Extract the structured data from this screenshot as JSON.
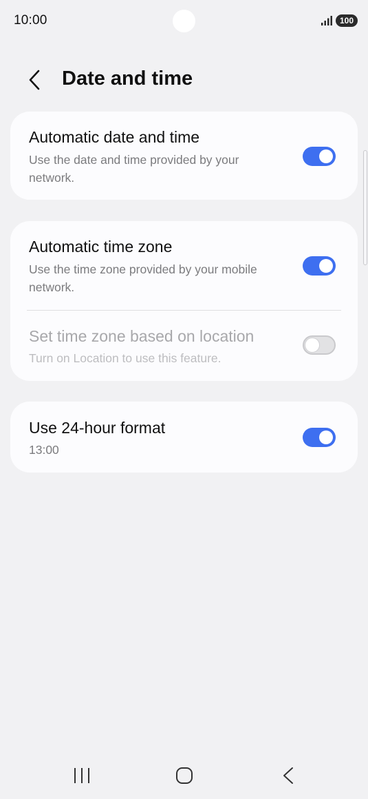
{
  "status_bar": {
    "time": "10:00",
    "battery": "100",
    "signal_icon": "signal-icon"
  },
  "header": {
    "title": "Date and time",
    "back_icon": "back-chevron-icon"
  },
  "settings": {
    "automatic_date_time": {
      "title": "Automatic date and time",
      "subtitle": "Use the date and time provided by your network.",
      "enabled": true
    },
    "automatic_time_zone": {
      "title": "Automatic time zone",
      "subtitle": "Use the time zone provided by your mobile network.",
      "enabled": true
    },
    "location_time_zone": {
      "title": "Set time zone based on location",
      "subtitle": "Turn on Location to use this feature.",
      "enabled": false,
      "disabled": true
    },
    "use_24_hour": {
      "title": "Use 24-hour format",
      "subtitle": "13:00",
      "enabled": true
    }
  },
  "nav_bar": {
    "recents_icon": "recent-apps-icon",
    "home_icon": "home-icon",
    "back_icon": "back-icon"
  },
  "colors": {
    "background": "#f1f1f3",
    "card": "#fcfcfe",
    "toggle_on": "#3e6ff0",
    "toggle_off": "#e2e2e4"
  }
}
